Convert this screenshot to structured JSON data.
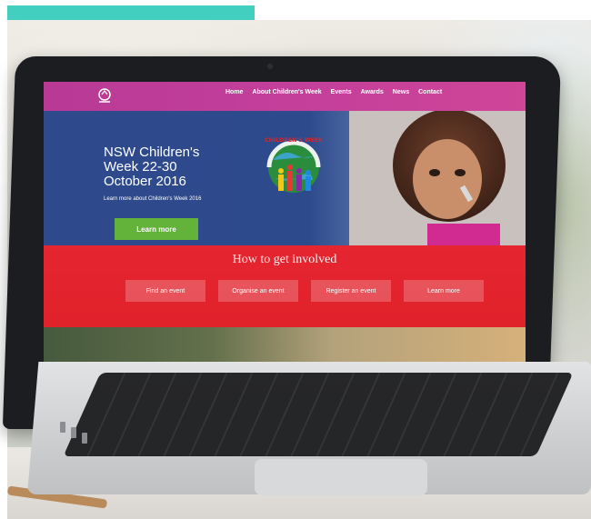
{
  "colors": {
    "accent_bar": "#42cfc0",
    "nav": "#c5409b",
    "hero_blue": "#2e4a8d",
    "cta_green": "#63b33a",
    "involved_red": "#e41e2d"
  },
  "site": {
    "nav": {
      "items": [
        {
          "label": "Home"
        },
        {
          "label": "About Children's Week"
        },
        {
          "label": "Events"
        },
        {
          "label": "Awards"
        },
        {
          "label": "News"
        },
        {
          "label": "Contact"
        }
      ]
    },
    "hero": {
      "title": "NSW Children's Week 22-30 October 2016",
      "subtitle": "Learn more about Children's Week 2016",
      "cta_label": "Learn more",
      "logo_text": "CHILDREN'S WEEK"
    },
    "involved": {
      "title": "How to get involved",
      "buttons": [
        {
          "label": "Find an event"
        },
        {
          "label": "Organise an event"
        },
        {
          "label": "Register an event"
        },
        {
          "label": "Learn more"
        }
      ]
    }
  }
}
